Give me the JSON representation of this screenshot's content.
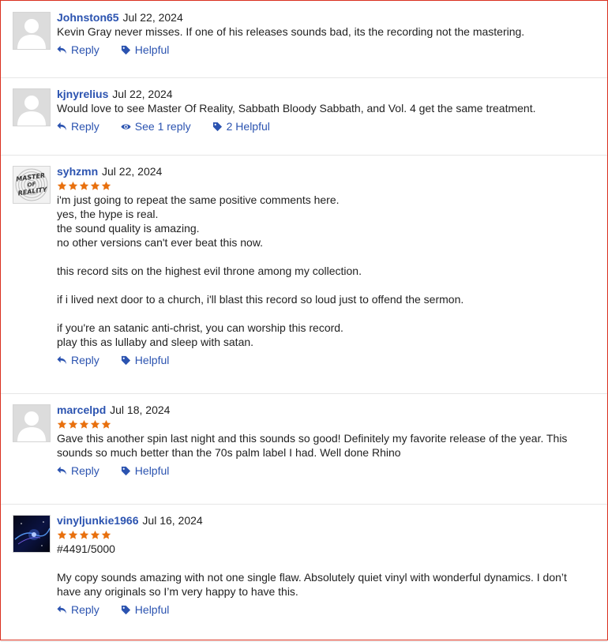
{
  "colors": {
    "link": "#2b53b0",
    "star": "#e8700e"
  },
  "reviews": [
    {
      "username": "Johnston65",
      "date": "Jul 22, 2024",
      "avatar": "default-avatar",
      "stars": 0,
      "lines": [
        "Kevin Gray never misses. If one of his releases sounds bad, its the recording not the mastering."
      ],
      "actions": {
        "reply": "Reply",
        "see_replies": null,
        "helpful": "Helpful"
      }
    },
    {
      "username": "kjnyrelius",
      "date": "Jul 22, 2024",
      "avatar": "default-avatar",
      "stars": 0,
      "lines": [
        "Would love to see Master Of Reality, Sabbath Bloody Sabbath, and Vol. 4 get the same treatment."
      ],
      "actions": {
        "reply": "Reply",
        "see_replies": "See 1 reply",
        "helpful": "2 Helpful"
      }
    },
    {
      "username": "syhzmn",
      "date": "Jul 22, 2024",
      "avatar": "master-of-reality-avatar",
      "avatar_text": [
        "MASTER",
        "OF",
        "REALITY"
      ],
      "stars": 5,
      "lines": [
        "i'm just going to repeat the same positive comments here.",
        "yes, the hype is real.",
        "the sound quality is amazing.",
        "no other versions can't ever beat this now.",
        "",
        "this record sits on the highest evil throne among my collection.",
        "",
        "if i lived next door to a church, i'll blast this record so loud just to offend the sermon.",
        "",
        "if you're an satanic anti-christ, you can worship this record.",
        "play this as lullaby and sleep with satan."
      ],
      "actions": {
        "reply": "Reply",
        "see_replies": null,
        "helpful": "Helpful"
      }
    },
    {
      "username": "marcelpd",
      "date": "Jul 18, 2024",
      "avatar": "default-avatar",
      "stars": 5,
      "lines": [
        "Gave this another spin last night and this sounds so good! Definitely my favorite release of the year. This",
        "sounds so much better than the 70s palm label I had. Well done Rhino"
      ],
      "actions": {
        "reply": "Reply",
        "see_replies": null,
        "helpful": "Helpful"
      }
    },
    {
      "username": "vinyljunkie1966",
      "date": "Jul 16, 2024",
      "avatar": "space-photo-avatar",
      "stars": 5,
      "lines": [
        "#4491/5000",
        "",
        "My copy sounds amazing with not one single flaw. Absolutely quiet vinyl with wonderful dynamics. I don’t",
        "have any originals so I’m very happy to have this."
      ],
      "actions": {
        "reply": "Reply",
        "see_replies": null,
        "helpful": "Helpful"
      }
    }
  ]
}
